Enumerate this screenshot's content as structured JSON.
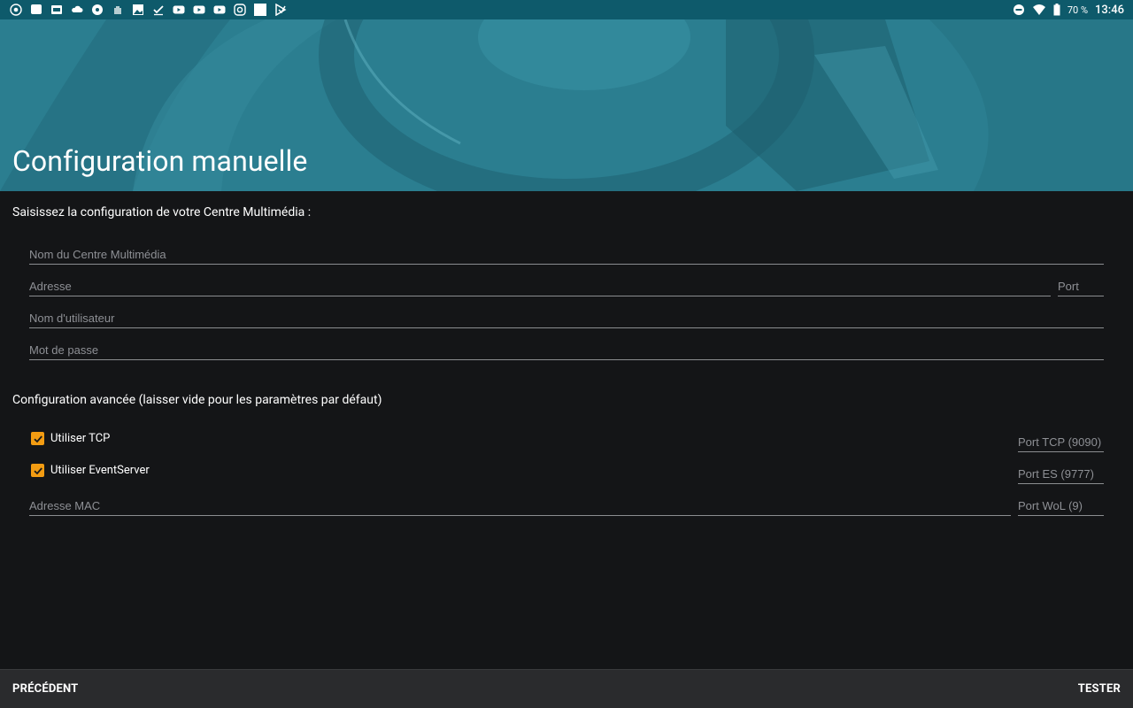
{
  "status_bar": {
    "left_icons": [
      "chrome-icon",
      "message-icon",
      "mail-icon",
      "cloud-icon",
      "circle-icon",
      "hand-icon",
      "image-icon",
      "check-icon",
      "youtube-icon",
      "youtube-icon",
      "youtube-icon",
      "instagram-icon",
      "square-icon",
      "play-store-icon"
    ],
    "battery": "70 %",
    "time": "13:46"
  },
  "header": {
    "title": "Configuration manuelle"
  },
  "main": {
    "intro": "Saisissez la configuration de votre Centre Multimédia :",
    "fields": {
      "name_placeholder": "Nom du Centre Multimédia",
      "address_placeholder": "Adresse",
      "port_placeholder": "Port",
      "username_placeholder": "Nom d'utilisateur",
      "password_placeholder": "Mot de passe"
    },
    "advanced_label": "Configuration avancée (laisser vide pour les paramètres par défaut)",
    "use_tcp_label": "Utiliser TCP",
    "use_tcp_checked": true,
    "tcp_port_placeholder": "Port TCP (9090)",
    "use_eventserver_label": "Utiliser EventServer",
    "use_eventserver_checked": true,
    "es_port_placeholder": "Port ES (9777)",
    "mac_placeholder": "Adresse MAC",
    "wol_port_placeholder": "Port WoL (9)"
  },
  "footer": {
    "previous_label": "PRÉCÉDENT",
    "test_label": "TESTER"
  },
  "colors": {
    "status_bar": "#0e5a6b",
    "header": "#2a7d8f",
    "background": "#141517",
    "accent": "#f39c12",
    "bottom_bar": "#2a2b2d"
  }
}
